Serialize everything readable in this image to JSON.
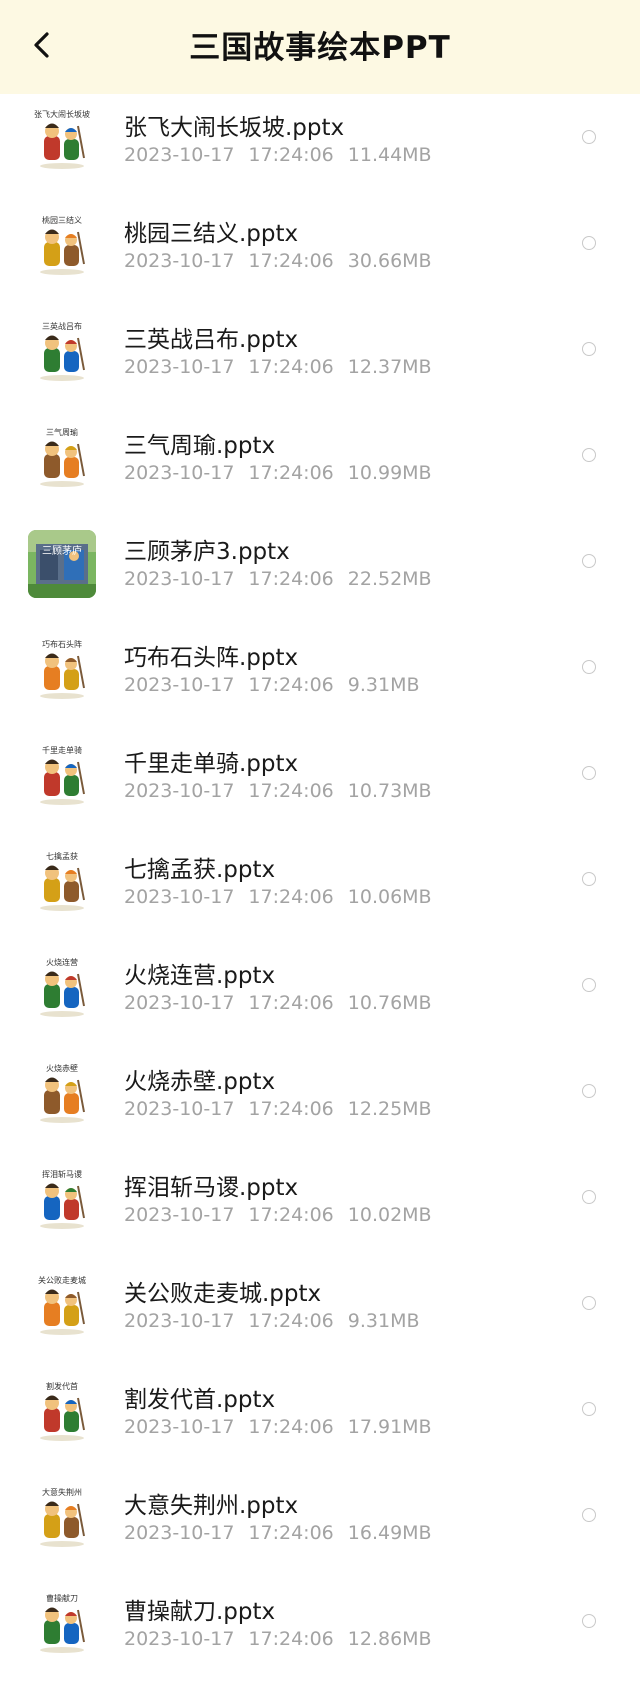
{
  "header": {
    "title": "三国故事绘本PPT",
    "back_icon": "chevron-left-icon"
  },
  "colors": {
    "header_bg": "#fdf9e3",
    "meta_text": "#a3a3a3",
    "radio_border": "#c9c9c9"
  },
  "files": [
    {
      "name": "张飞大闹长坂坡.pptx",
      "date": "2023-10-17",
      "time": "17:24:06",
      "size": "11.44MB",
      "thumb_caption": "张飞大闹长坂坡",
      "thumb_kind": "figure"
    },
    {
      "name": "桃园三结义.pptx",
      "date": "2023-10-17",
      "time": "17:24:06",
      "size": "30.66MB",
      "thumb_caption": "桃园三结义",
      "thumb_kind": "figure"
    },
    {
      "name": "三英战吕布.pptx",
      "date": "2023-10-17",
      "time": "17:24:06",
      "size": "12.37MB",
      "thumb_caption": "三英战吕布",
      "thumb_kind": "figure"
    },
    {
      "name": "三气周瑜.pptx",
      "date": "2023-10-17",
      "time": "17:24:06",
      "size": "10.99MB",
      "thumb_caption": "三气周瑜",
      "thumb_kind": "figure"
    },
    {
      "name": "三顾茅庐3.pptx",
      "date": "2023-10-17",
      "time": "17:24:06",
      "size": "22.52MB",
      "thumb_caption": "三顾茅庐",
      "thumb_kind": "scene"
    },
    {
      "name": "巧布石头阵.pptx",
      "date": "2023-10-17",
      "time": "17:24:06",
      "size": "9.31MB",
      "thumb_caption": "巧布石头阵",
      "thumb_kind": "figure"
    },
    {
      "name": "千里走单骑.pptx",
      "date": "2023-10-17",
      "time": "17:24:06",
      "size": "10.73MB",
      "thumb_caption": "千里走单骑",
      "thumb_kind": "figure"
    },
    {
      "name": "七擒孟获.pptx",
      "date": "2023-10-17",
      "time": "17:24:06",
      "size": "10.06MB",
      "thumb_caption": "七擒孟获",
      "thumb_kind": "figure"
    },
    {
      "name": "火烧连营.pptx",
      "date": "2023-10-17",
      "time": "17:24:06",
      "size": "10.76MB",
      "thumb_caption": "火烧连营",
      "thumb_kind": "figure"
    },
    {
      "name": "火烧赤壁.pptx",
      "date": "2023-10-17",
      "time": "17:24:06",
      "size": "12.25MB",
      "thumb_caption": "火烧赤壁",
      "thumb_kind": "figure"
    },
    {
      "name": "挥泪斩马谡.pptx",
      "date": "2023-10-17",
      "time": "17:24:06",
      "size": "10.02MB",
      "thumb_caption": "挥泪斩马谡",
      "thumb_kind": "figure"
    },
    {
      "name": "关公败走麦城.pptx",
      "date": "2023-10-17",
      "time": "17:24:06",
      "size": "9.31MB",
      "thumb_caption": "关公败走麦城",
      "thumb_kind": "figure"
    },
    {
      "name": "割发代首.pptx",
      "date": "2023-10-17",
      "time": "17:24:06",
      "size": "17.91MB",
      "thumb_caption": "割发代首",
      "thumb_kind": "figure"
    },
    {
      "name": "大意失荆州.pptx",
      "date": "2023-10-17",
      "time": "17:24:06",
      "size": "16.49MB",
      "thumb_caption": "大意失荆州",
      "thumb_kind": "figure"
    },
    {
      "name": "曹操献刀.pptx",
      "date": "2023-10-17",
      "time": "17:24:06",
      "size": "12.86MB",
      "thumb_caption": "曹操献刀",
      "thumb_kind": "figure"
    }
  ]
}
